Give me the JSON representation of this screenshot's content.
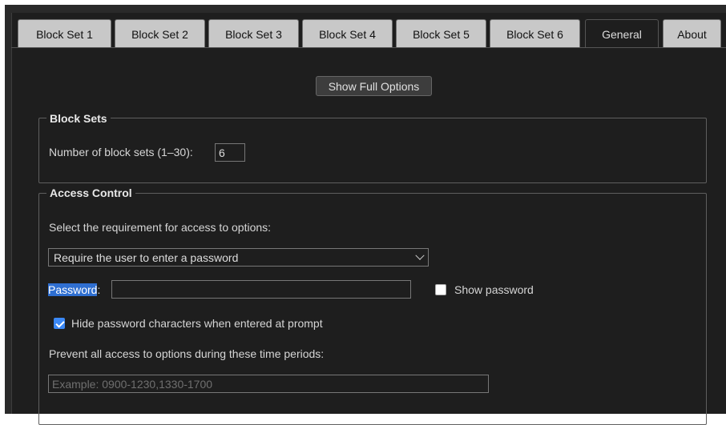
{
  "tabs": [
    {
      "label": "Block Set 1",
      "active": false
    },
    {
      "label": "Block Set 2",
      "active": false
    },
    {
      "label": "Block Set 3",
      "active": false
    },
    {
      "label": "Block Set 4",
      "active": false
    },
    {
      "label": "Block Set 5",
      "active": false
    },
    {
      "label": "Block Set 6",
      "active": false
    },
    {
      "label": "General",
      "active": true
    },
    {
      "label": "About",
      "active": false
    }
  ],
  "show_full_options_label": "Show Full Options",
  "block_sets": {
    "legend": "Block Sets",
    "count_label": "Number of block sets (1–30):",
    "count_value": "6"
  },
  "access_control": {
    "legend": "Access Control",
    "requirement_label": "Select the requirement for access to options:",
    "requirement_selected": "Require the user to enter a password",
    "password_label": "Password",
    "password_colon": ":",
    "password_value": "",
    "show_password_label": "Show password",
    "show_password_checked": false,
    "hide_chars_label": "Hide password characters when entered at prompt",
    "hide_chars_checked": true,
    "time_periods_label": "Prevent all access to options during these time periods:",
    "time_periods_placeholder": "Example: 0900-1230,1330-1700",
    "time_periods_value": ""
  },
  "colors": {
    "background": "#1e1e1e",
    "tab_inactive": "#c8c8c8",
    "checkbox_accent": "#3b88f5",
    "selection_highlight": "#2f6fd1"
  }
}
